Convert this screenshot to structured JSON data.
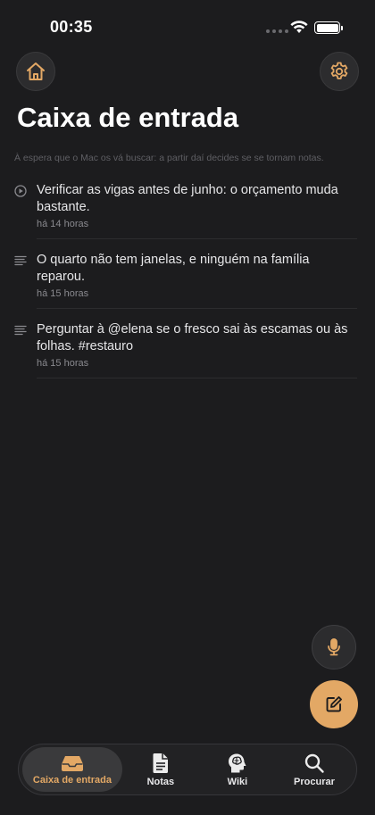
{
  "status_bar": {
    "time": "00:35"
  },
  "header": {
    "title": "Caixa de entrada",
    "subtitle": "À espera que o Mac os vá buscar: a partir daí decides se se tornam notas."
  },
  "inbox": {
    "items": [
      {
        "type": "audio",
        "icon": "play-circle-icon",
        "text": "Verificar as vigas antes de junho: o orçamento muda bastante.",
        "time": "há 14 horas"
      },
      {
        "type": "text",
        "icon": "text-lines-icon",
        "text": "O quarto não tem janelas, e ninguém na família reparou.",
        "time": "há 15 horas"
      },
      {
        "type": "text",
        "icon": "text-lines-icon",
        "text": "Perguntar à @elena se o fresco sai às escamas ou às folhas. #restauro",
        "time": "há 15 horas"
      }
    ]
  },
  "tabs": [
    {
      "label": "Caixa de entrada",
      "icon": "inbox-tray-icon",
      "active": true
    },
    {
      "label": "Notas",
      "icon": "document-icon",
      "active": false
    },
    {
      "label": "Wiki",
      "icon": "brain-head-icon",
      "active": false
    },
    {
      "label": "Procurar",
      "icon": "search-icon",
      "active": false
    }
  ],
  "colors": {
    "accent": "#e3a865",
    "background": "#1c1c1e",
    "surface": "#2c2c2e"
  }
}
